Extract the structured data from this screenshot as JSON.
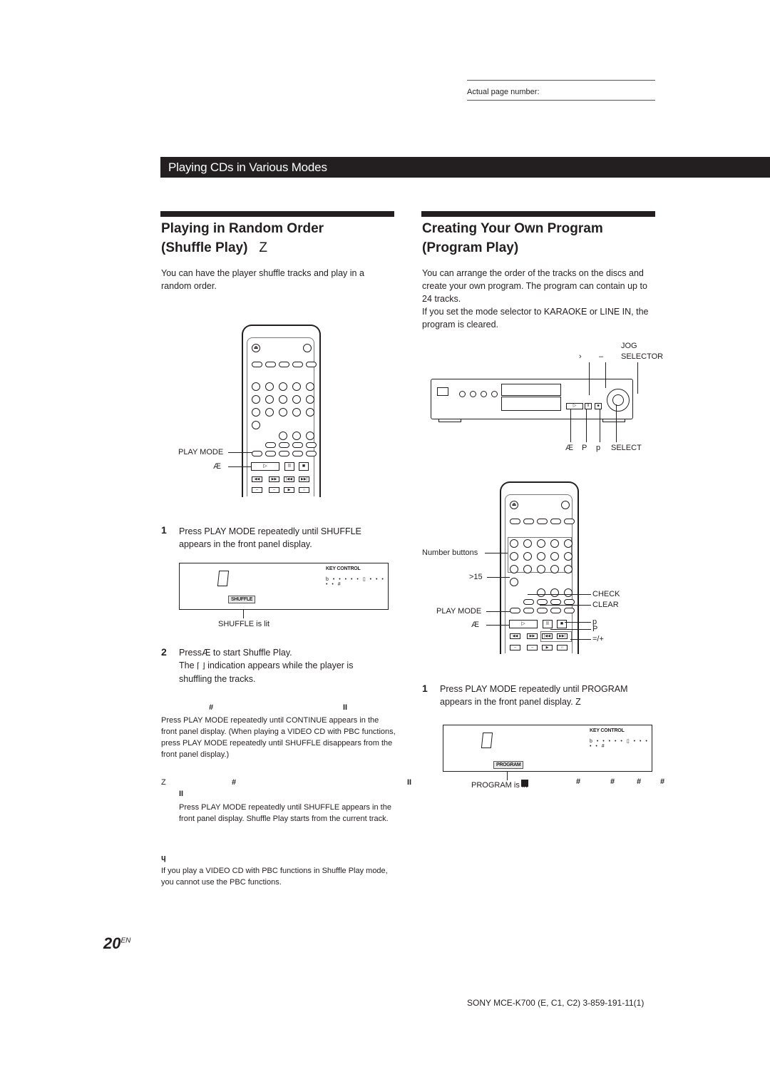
{
  "page_header": {
    "actual_page_label": "Actual page number:"
  },
  "section": {
    "title": "Playing CDs in Various Modes"
  },
  "left": {
    "heading_line1": "Playing in Random Order",
    "heading_line2": "(Shuffle Play)",
    "heading_symbol": "Z",
    "intro": "You can have the player  shuffle  tracks and play in a random order.",
    "remote_labels": {
      "play_mode": "PLAY MODE",
      "play": "Æ"
    },
    "steps": [
      {
        "number": "1",
        "text_line1": "Press PLAY MODE repeatedly until  SHUFFLE",
        "text_line2": "appears in the front panel display."
      },
      {
        "number": "2",
        "text_line1": "PressÆ   to start Shuffle Play.",
        "text_line2_a": "The",
        "text_line2_b": "indication appears while the player is",
        "text_line3": " shuffling  the tracks."
      }
    ],
    "display": {
      "digit": "0",
      "key_control_label": "KEY   CONTROL",
      "key_scale": "b • • • • • ▯ • • • • • #",
      "badge": "SHUFFLE",
      "caption": "SHUFFLE  is lit"
    },
    "tip1": {
      "symbol_a": "#",
      "symbol_b": "II",
      "text": "Press PLAY MODE repeatedly until  CONTINUE  appears in the front panel display. (When playing a VIDEO CD with PBC functions, press PLAY MODE repeatedly until  SHUFFLE disappears from the front panel display.)"
    },
    "tip2": {
      "symbol_z": "Z",
      "symbol_a": "#",
      "symbol_b": "II",
      "symbol_c": "II",
      "text": "Press PLAY MODE repeatedly until  SHUFFLE  appears in the front panel display. Shuffle Play starts from the current track."
    },
    "note": {
      "symbol": "ɥ",
      "text": "If you play a VIDEO CD with PBC functions in Shuffle Play mode, you cannot use the PBC functions."
    }
  },
  "right": {
    "heading_line1": "Creating Your Own Program",
    "heading_line2": "(Program Play)",
    "intro": "You can arrange the order of the tracks on the discs and create your own program. The program can contain up to 24 tracks.",
    "intro2": "If you set the mode selector to KARAOKE or LINE IN, the program is cleared.",
    "player_labels": {
      "jog": "JOG",
      "selector": "SELECTOR",
      "top_a": "›",
      "top_b": "–",
      "play": "Æ",
      "pause": "P",
      "stop": "p",
      "select": "SELECT"
    },
    "remote_labels": {
      "number_buttons": "Number buttons",
      "gt15": ">15",
      "check": "CHECK",
      "clear": "CLEAR",
      "play_mode": "PLAY MODE",
      "play": "Æ",
      "stop": "p",
      "pause": "P",
      "skip": "=/+"
    },
    "steps": [
      {
        "number": "1",
        "text_line1": "Press PLAY MODE repeatedly until  PROGRAM",
        "text_line2": "appears in the front panel display.  Z"
      }
    ],
    "display": {
      "digit": "0",
      "key_control_label": "KEY   CONTROL",
      "key_scale": "b • • • • • ▯ • • • • • #",
      "badge": "PROGRAM",
      "caption": "PROGRAM  is lit",
      "trailing_symbols": [
        "#",
        "#",
        "#",
        "#"
      ]
    }
  },
  "footer": {
    "page_number": "20",
    "page_suffix": "EN",
    "model": "SONY MCE-K700 (E, C1, C2) 3-859-191-11(1)"
  }
}
